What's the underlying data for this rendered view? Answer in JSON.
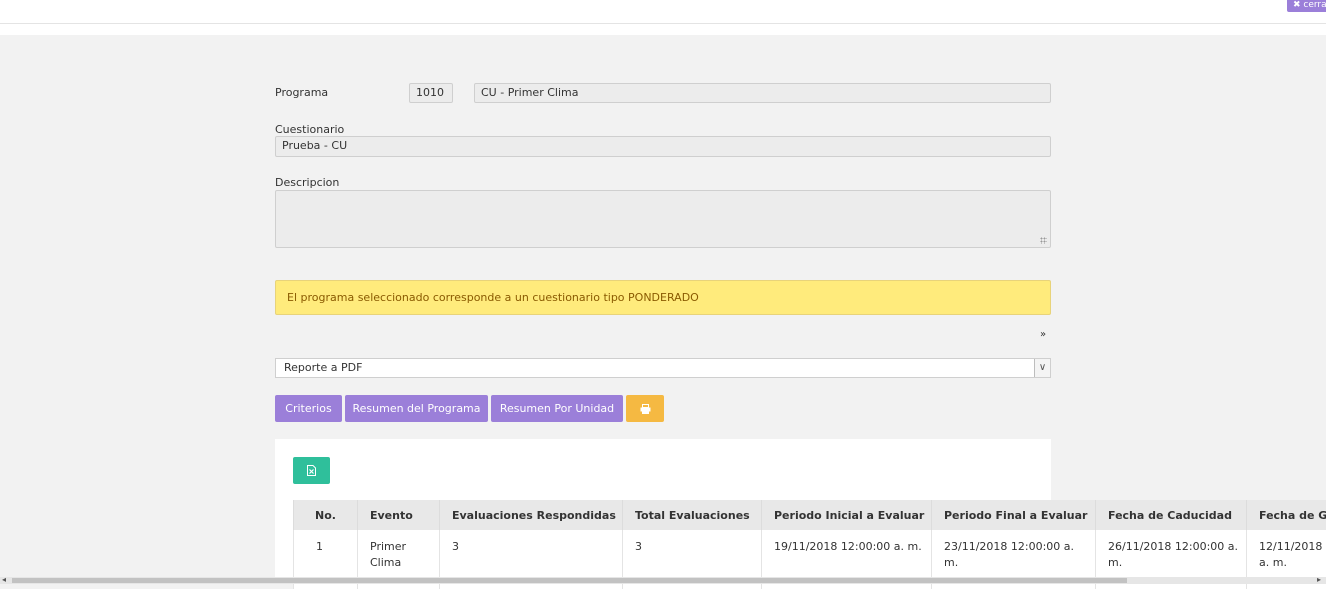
{
  "header": {
    "close_label": "✖ cerrar"
  },
  "form": {
    "programa_label": "Programa",
    "programa_code": "1010",
    "programa_name": "CU - Primer Clima",
    "cuestionario_label": "Cuestionario",
    "cuestionario_value": "Prueba - CU",
    "descripcion_label": "Descripcion",
    "descripcion_value": ""
  },
  "alert": {
    "text": "El programa seleccionado corresponde a un cuestionario tipo PONDERADO"
  },
  "collapse_icon": "double-chevron-down-icon",
  "report_select": {
    "selected": "Reporte a PDF"
  },
  "buttons": {
    "criterios": "Criterios",
    "resumen_programa": "Resumen del Programa",
    "resumen_unidad": "Resumen Por Unidad",
    "print_icon": "print-icon",
    "excel_icon": "excel-icon"
  },
  "table": {
    "headers": [
      "No.",
      "Evento",
      "Evaluaciones Respondidas",
      "Total Evaluaciones",
      "Periodo Inicial a Evaluar",
      "Periodo Final a Evaluar",
      "Fecha de Caducidad",
      "Fecha de G"
    ],
    "rows": [
      [
        "1",
        "Primer Clima",
        "3",
        "3",
        "19/11/2018 12:00:00 a. m.",
        "23/11/2018 12:00:00 a. m.",
        "26/11/2018 12:00:00 a. m.",
        "12/11/2018 a. m."
      ]
    ]
  },
  "colors": {
    "purple_button": "#9b7fd9",
    "print_button": "#f5b942",
    "excel_button": "#2fbf9b",
    "alert_bg": "#ffeb7c",
    "alert_text": "#8a5a00"
  }
}
